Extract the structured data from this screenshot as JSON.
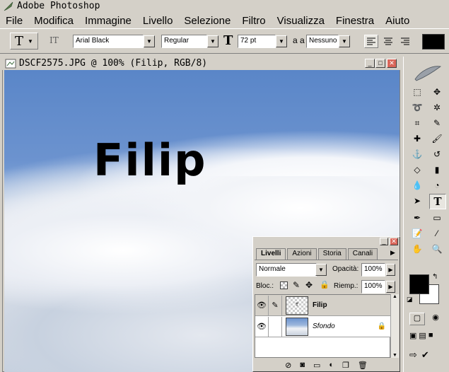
{
  "window": {
    "title": "Adobe Photoshop"
  },
  "menu": {
    "items": [
      "File",
      "Modifica",
      "Immagine",
      "Livello",
      "Selezione",
      "Filtro",
      "Visualizza",
      "Finestra",
      "Aiuto"
    ]
  },
  "options": {
    "tool_glyph": "T",
    "orient_glyph": "IT",
    "font_family": "Arial Black",
    "font_style": "Regular",
    "size_glyph": "T",
    "font_size": "72 pt",
    "aa_glyph": "a a",
    "antialias": "Nessuno",
    "color_hex": "#000000"
  },
  "document": {
    "title": "DSCF2575.JPG @ 100% (Filip, RGB/8)",
    "text_layer_content": "Filip"
  },
  "layers_panel": {
    "tabs": [
      "Livelli",
      "Azioni",
      "Storia",
      "Canali"
    ],
    "blend_mode": "Normale",
    "opacity_label": "Opacità:",
    "opacity_value": "100%",
    "lock_label": "Bloc.:",
    "fill_label": "Riemp.:",
    "fill_value": "100%",
    "layers": [
      {
        "name": "Filip",
        "type": "text",
        "selected": true
      },
      {
        "name": "Sfondo",
        "type": "background",
        "locked": true
      }
    ]
  },
  "colors": {
    "ui_gray": "#d4d0c8",
    "foreground": "#000000",
    "background": "#ffffff",
    "sky": "#6c93cf"
  }
}
